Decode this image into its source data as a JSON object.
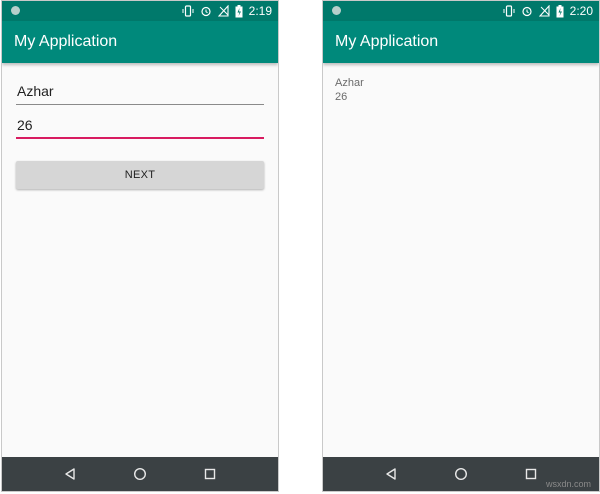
{
  "left": {
    "status_time": "2:19",
    "app_title": "My Application",
    "name_field": "Azhar",
    "age_field": "26",
    "next_button": "NEXT"
  },
  "right": {
    "status_time": "2:20",
    "app_title": "My Application",
    "output_name": "Azhar",
    "output_age": "26"
  },
  "navbar_icons": [
    "back-icon",
    "home-icon",
    "recents-icon"
  ],
  "colors": {
    "status_bar": "#00796b",
    "app_bar": "#00897b",
    "focus_underline": "#d81b60",
    "nav_bar": "#3b4144"
  },
  "watermark": "wsxdn.com"
}
